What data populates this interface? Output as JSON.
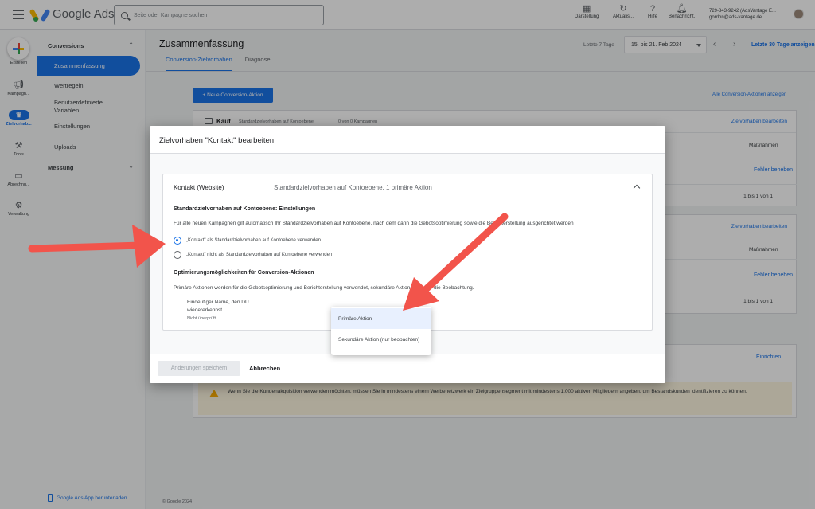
{
  "topbar": {
    "app_name": "Google Ads",
    "search_placeholder": "Seite oder Kampagne suchen",
    "actions": [
      "Darstellung",
      "Aktualis...",
      "Hilfe",
      "Benachricht."
    ],
    "account_id": "729-843-9242 (AdsVantage E...",
    "account_email": "gordon@ads-vantage.de"
  },
  "rail": [
    "Erstellen",
    "Kampagn...",
    "Zielvorhab...",
    "Tools",
    "Abrechnu...",
    "Verwaltung"
  ],
  "nav": {
    "section1": "Conversions",
    "active": "Zusammenfassung",
    "items": [
      "Wertregeln",
      "Benutzerdefinierte",
      "Variablen",
      "Einstellungen",
      "Uploads"
    ],
    "section2": "Messung",
    "app_download": "Google Ads App herunterladen"
  },
  "main": {
    "title": "Zusammenfassung",
    "tabs": [
      "Conversion-Zielvorhaben",
      "Diagnose"
    ],
    "date_label": "Letzte 7 Tage",
    "date_value": "15. bis 21. Feb 2024",
    "last30": "Letzte 30 Tage anzeigen",
    "new_button": "+ Neue Conversion-Aktion",
    "all_link": "Alle Conversion-Aktionen anzeigen",
    "card1": {
      "title": "Kauf",
      "sub": "Standardzielvorhaben auf Kontoebene",
      "count": "0 von 0 Kampagnen",
      "edit": "Zielvorhaben bearbeiten",
      "col": "Maßnahmen",
      "action": "Fehler beheben",
      "pager": "1 bis 1 von 1"
    },
    "card2": {
      "edit": "Zielvorhaben bearbeiten",
      "col": "Maßnahmen",
      "action": "Fehler beheben",
      "pager": "1 bis 1 von 1"
    },
    "einrichten": "Einrichten",
    "warning": "Wenn Sie die Kundenakquisition verwenden möchten, müssen Sie in mindestens einem Werbenetzwerk ein Zielgruppensegment mit mindestens 1.000 aktiven Mitgliedern angeben, um Bestandskunden identifizieren zu können.",
    "footer": "© Google 2024"
  },
  "dialog": {
    "title": "Zielvorhaben \"Kontakt\" bearbeiten",
    "panel_name": "Kontakt (Website)",
    "panel_desc": "Standardzielvorhaben auf Kontoebene, 1 primäre Aktion",
    "section1_heading": "Standardzielvorhaben auf Kontoebene: Einstellungen",
    "section1_text": "Für alle neuen Kampagnen gilt automatisch Ihr Standardzielvorhaben auf Kontoebene, nach dem dann die Gebotsoptimierung sowie die Berichterstellung ausgerichtet werden",
    "radio1": "„Kontakt\" als Standardzielvorhaben auf Kontoebene verwenden",
    "radio2": "„Kontakt\" nicht als Standardzielvorhaben auf Kontoebene verwenden",
    "section2_heading": "Optimierungsmöglichkeiten für Conversion-Aktionen",
    "section2_text": "Primäre Aktionen werden für die Gebotsoptimierung und Berichterstellung verwendet, sekundäre Aktionen nur für die Beobachtung.",
    "field_label_1": "Eindeutiger Name, den DU",
    "field_label_2": "wiedererkennst",
    "field_status": "Nicht überprüft",
    "dropdown": [
      "Primäre Aktion",
      "Sekundäre Aktion (nur beobachten)"
    ],
    "save": "Änderungen speichern",
    "cancel": "Abbrechen"
  },
  "colors": {
    "accent": "#1a73e8",
    "arrow": "#f2544b"
  }
}
